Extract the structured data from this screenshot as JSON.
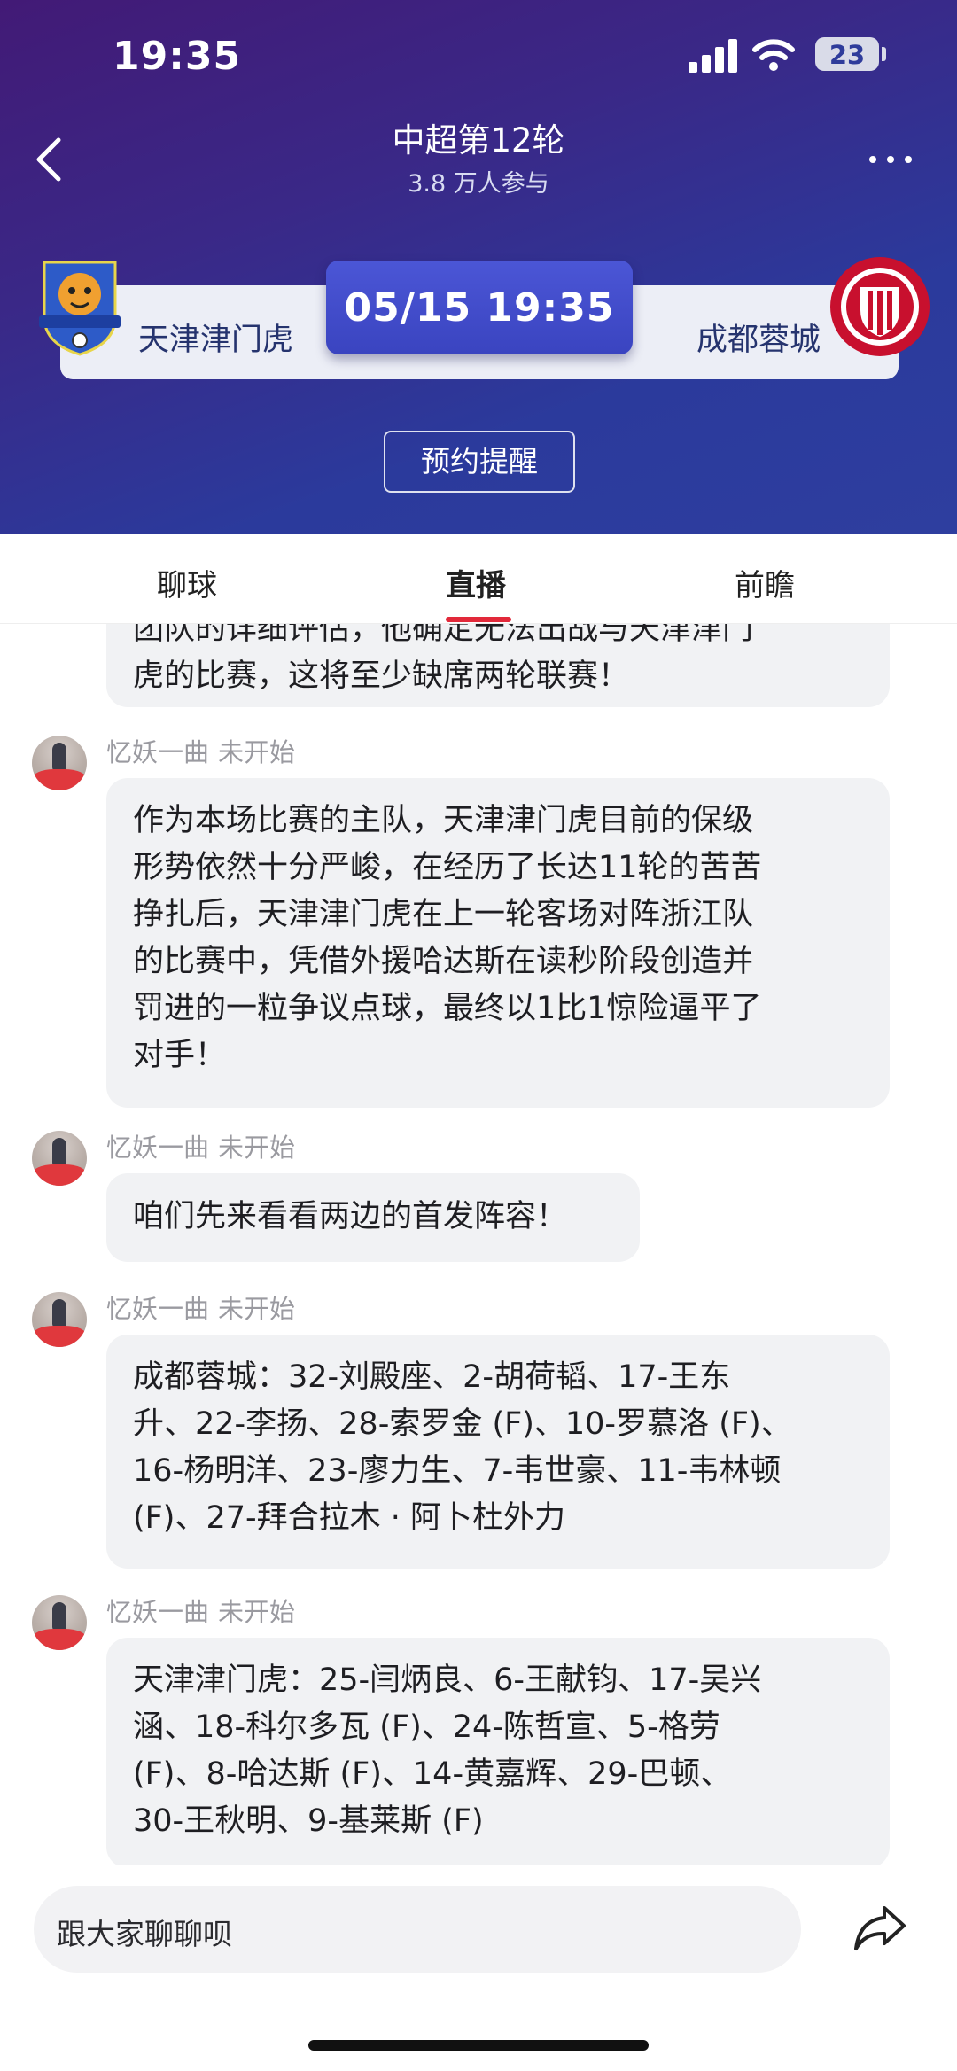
{
  "status_bar": {
    "time": "19:35",
    "battery": "23"
  },
  "header": {
    "title": "中超第12轮",
    "participants": "3.8 万人参与"
  },
  "match": {
    "home_team": "天津津门虎",
    "away_team": "成都蓉城",
    "kickoff": "05/15 19:35",
    "reminder_label": "预约提醒"
  },
  "tabs": [
    {
      "label": "聊球",
      "active": false
    },
    {
      "label": "直播",
      "active": true
    },
    {
      "label": "前瞻",
      "active": false
    }
  ],
  "feed": {
    "partial_message": {
      "lines": [
        "团队的详细评估，他确定无法出战与天津津门",
        "虎的比赛，这将至少缺席两轮联赛！"
      ]
    },
    "messages": [
      {
        "author": "忆妖一曲",
        "status": "未开始",
        "lines": [
          "作为本场比赛的主队，天津津门虎目前的保级",
          "形势依然十分严峻，在经历了长达11轮的苦苦",
          "挣扎后，天津津门虎在上一轮客场对阵浙江队",
          "的比赛中，凭借外援哈达斯在读秒阶段创造并",
          "罚进的一粒争议点球，最终以1比1惊险逼平了",
          "对手！"
        ]
      },
      {
        "author": "忆妖一曲",
        "status": "未开始",
        "lines": [
          "咱们先来看看两边的首发阵容！"
        ]
      },
      {
        "author": "忆妖一曲",
        "status": "未开始",
        "lines": [
          "成都蓉城：32-刘殿座、2-胡荷韬、17-王东",
          "升、22-李扬、28-索罗金 (F)、10-罗慕洛 (F)、",
          "16-杨明洋、23-廖力生、7-韦世豪、11-韦林顿",
          "(F)、27-拜合拉木 · 阿卜杜外力"
        ]
      },
      {
        "author": "忆妖一曲",
        "status": "未开始",
        "lines": [
          "天津津门虎：25-闫炳良、6-王献钧、17-吴兴",
          "涵、18-科尔多瓦 (F)、24-陈哲宣、5-格劳",
          "(F)、8-哈达斯 (F)、14-黄嘉辉、29-巴顿、",
          "30-王秋明、9-基莱斯 (F)"
        ]
      }
    ]
  },
  "composer": {
    "placeholder": "跟大家聊聊呗"
  },
  "icons": {
    "back": "chevron-left-icon",
    "more": "more-dots-icon",
    "share": "share-arrow-icon"
  },
  "colors": {
    "accent_red": "#e2293a",
    "header_blue": "#2e3e9f",
    "time_box": "#4350cc"
  }
}
